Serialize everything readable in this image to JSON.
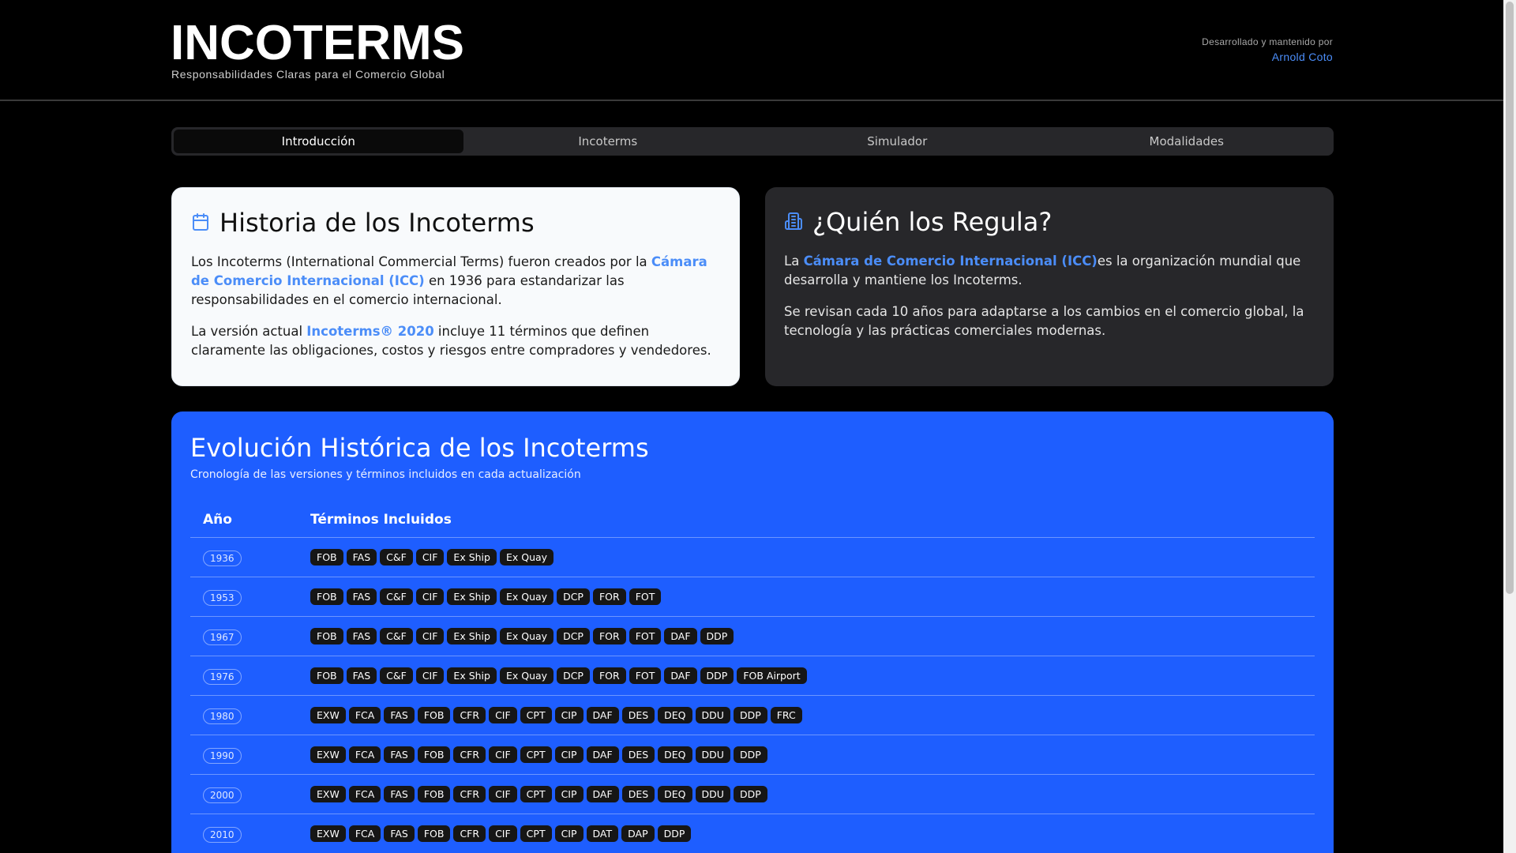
{
  "header": {
    "title": "INCOTERMS",
    "subtitle": "Responsabilidades Claras para el Comercio Global",
    "credit_label": "Desarrollado y mantenido por",
    "credit_author": "Arnold Coto"
  },
  "tabs": [
    {
      "label": "Introducción",
      "active": true
    },
    {
      "label": "Incoterms",
      "active": false
    },
    {
      "label": "Simulador",
      "active": false
    },
    {
      "label": "Modalidades",
      "active": false
    }
  ],
  "history_card": {
    "title": "Historia de los Incoterms",
    "icon": "calendar-icon",
    "p1_before": "Los Incoterms (International Commercial Terms) fueron creados por la ",
    "p1_highlight": "Cámara de Comercio Internacional (ICC)",
    "p1_after": " en 1936 para estandarizar las responsabilidades en el comercio internacional.",
    "p2_before": "La versión actual ",
    "p2_highlight": "Incoterms® 2020",
    "p2_after": " incluye 11 términos que definen claramente las obligaciones, costos y riesgos entre compradores y vendedores."
  },
  "regulator_card": {
    "title": "¿Quién los Regula?",
    "icon": "building-icon",
    "p1_before": "La ",
    "p1_highlight": "Cámara de Comercio Internacional (ICC)",
    "p1_after": "es la organización mundial que desarrolla y mantiene los Incoterms.",
    "p2": "Se revisan cada 10 años para adaptarse a los cambios en el comercio global, la tecnología y las prácticas comerciales modernas."
  },
  "timeline": {
    "title": "Evolución Histórica de los Incoterms",
    "subtitle": "Cronología de las versiones y términos incluidos en cada actualización",
    "col_year": "Año",
    "col_terms": "Términos Incluidos",
    "rows": [
      {
        "year": "1936",
        "terms": [
          "FOB",
          "FAS",
          "C&F",
          "CIF",
          "Ex Ship",
          "Ex Quay"
        ]
      },
      {
        "year": "1953",
        "terms": [
          "FOB",
          "FAS",
          "C&F",
          "CIF",
          "Ex Ship",
          "Ex Quay",
          "DCP",
          "FOR",
          "FOT"
        ]
      },
      {
        "year": "1967",
        "terms": [
          "FOB",
          "FAS",
          "C&F",
          "CIF",
          "Ex Ship",
          "Ex Quay",
          "DCP",
          "FOR",
          "FOT",
          "DAF",
          "DDP"
        ]
      },
      {
        "year": "1976",
        "terms": [
          "FOB",
          "FAS",
          "C&F",
          "CIF",
          "Ex Ship",
          "Ex Quay",
          "DCP",
          "FOR",
          "FOT",
          "DAF",
          "DDP",
          "FOB Airport"
        ]
      },
      {
        "year": "1980",
        "terms": [
          "EXW",
          "FCA",
          "FAS",
          "FOB",
          "CFR",
          "CIF",
          "CPT",
          "CIP",
          "DAF",
          "DES",
          "DEQ",
          "DDU",
          "DDP",
          "FRC"
        ]
      },
      {
        "year": "1990",
        "terms": [
          "EXW",
          "FCA",
          "FAS",
          "FOB",
          "CFR",
          "CIF",
          "CPT",
          "CIP",
          "DAF",
          "DES",
          "DEQ",
          "DDU",
          "DDP"
        ]
      },
      {
        "year": "2000",
        "terms": [
          "EXW",
          "FCA",
          "FAS",
          "FOB",
          "CFR",
          "CIF",
          "CPT",
          "CIP",
          "DAF",
          "DES",
          "DEQ",
          "DDU",
          "DDP"
        ]
      },
      {
        "year": "2010",
        "terms": [
          "EXW",
          "FCA",
          "FAS",
          "FOB",
          "CFR",
          "CIF",
          "CPT",
          "CIP",
          "DAT",
          "DAP",
          "DDP"
        ]
      }
    ]
  },
  "colors": {
    "accent": "#4b8df8",
    "timeline_bg": "#1e5eff",
    "page_bg": "#000000"
  }
}
